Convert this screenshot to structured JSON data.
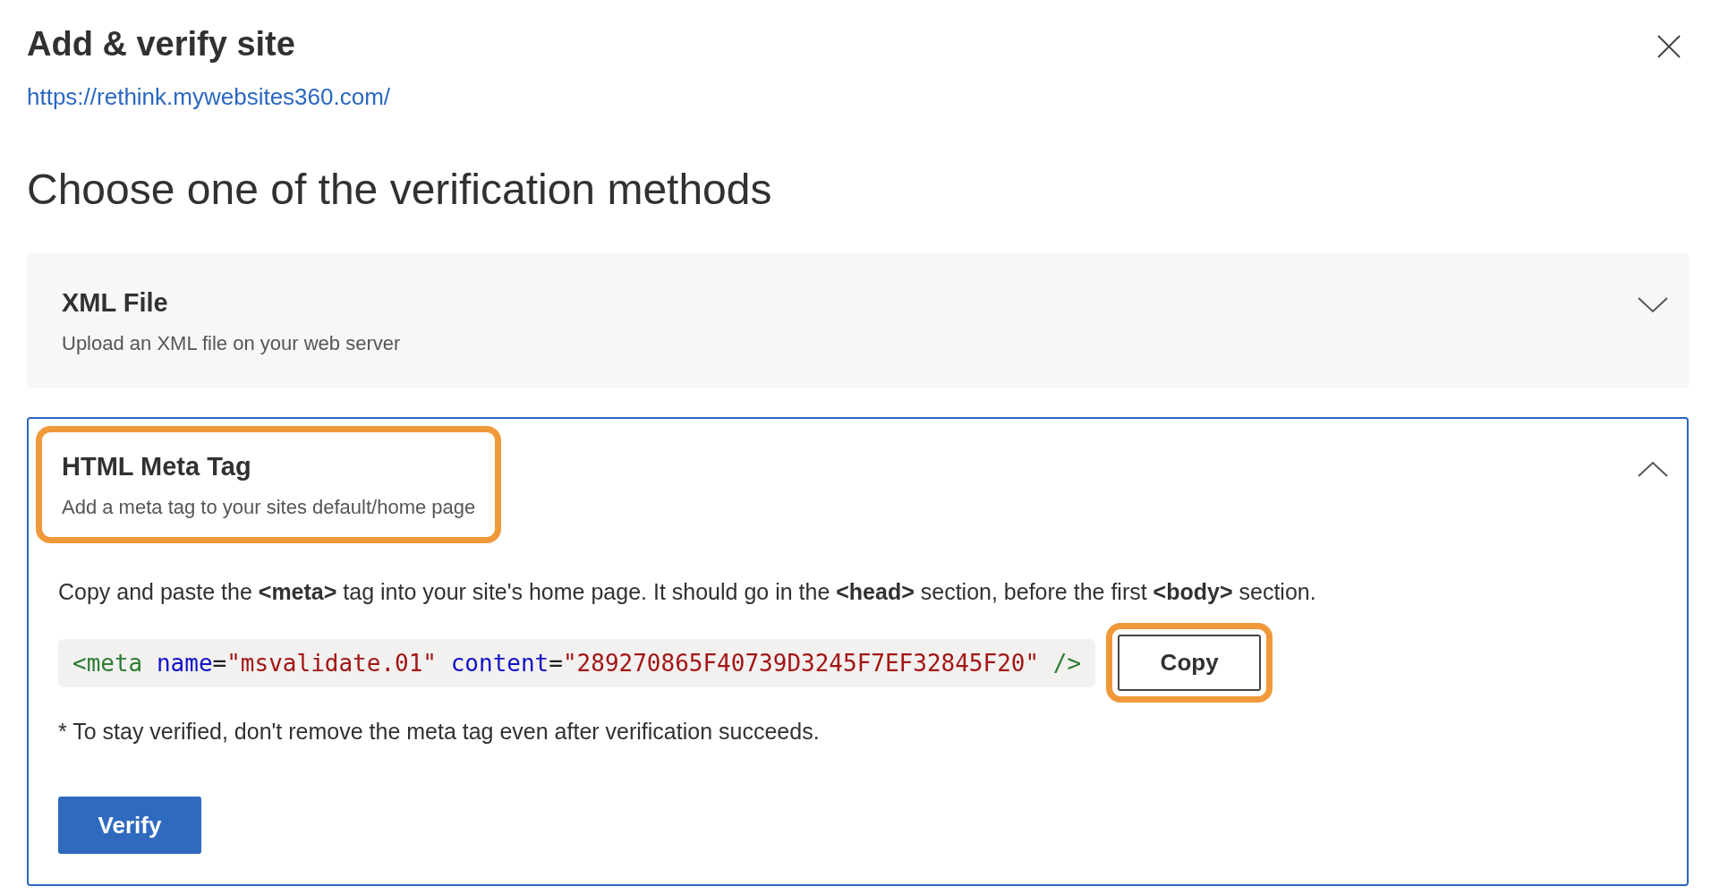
{
  "dialog": {
    "title": "Add & verify site",
    "site_url": "https://rethink.mywebsites360.com/"
  },
  "heading": "Choose one of the verification methods",
  "methods": [
    {
      "title": "XML File",
      "description": "Upload an XML file on your web server",
      "expanded": false,
      "highlighted": false
    },
    {
      "title": "HTML Meta Tag",
      "description": "Add a meta tag to your sites default/home page",
      "expanded": true,
      "highlighted": true,
      "instructions": "Copy and paste the **<meta>** tag into your site's home page. It should go in the **<head>** section, before the first **<body>** section.",
      "code_tokens": [
        {
          "kind": "tag",
          "text": "<meta"
        },
        {
          "kind": "attr",
          "text": " name"
        },
        {
          "kind": "punct",
          "text": "="
        },
        {
          "kind": "string",
          "text": "\"msvalidate.01\""
        },
        {
          "kind": "attr",
          "text": " content"
        },
        {
          "kind": "punct",
          "text": "="
        },
        {
          "kind": "string",
          "text": "\"289270865F40739D3245F7EF32845F20\""
        },
        {
          "kind": "tag",
          "text": " />"
        }
      ],
      "copy_button": {
        "label": "Copy",
        "highlighted": true
      },
      "note": "* To stay verified, don't remove the meta tag even after verification succeeds.",
      "verify_button": "Verify"
    }
  ]
}
